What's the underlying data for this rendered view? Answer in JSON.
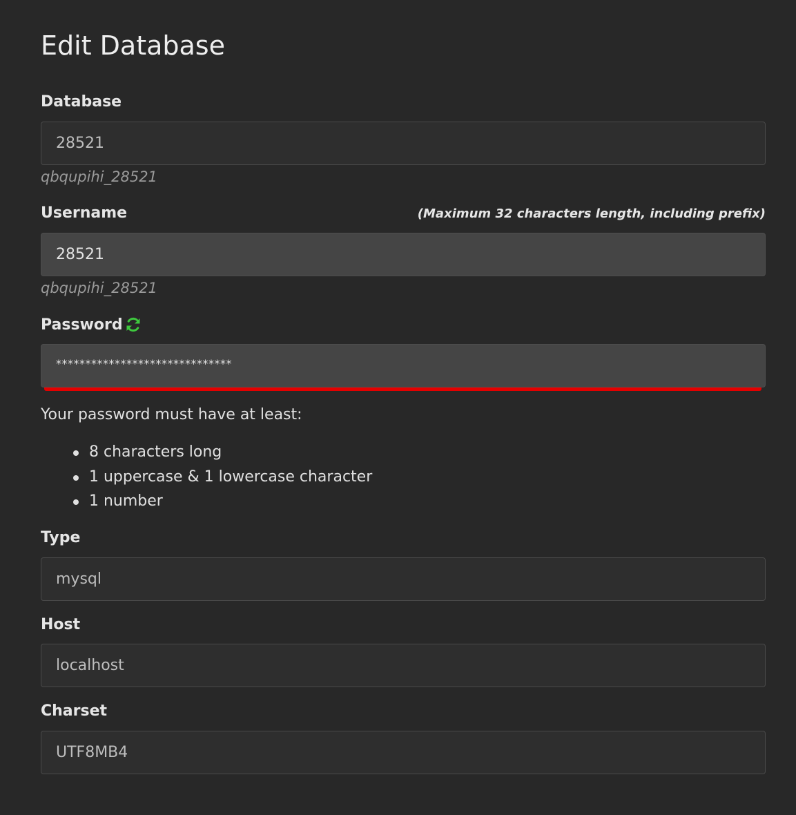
{
  "page": {
    "title": "Edit Database"
  },
  "database": {
    "label": "Database",
    "value": "28521",
    "prefixed": "qbqupihi_28521"
  },
  "username": {
    "label": "Username",
    "hint": "(Maximum 32 characters length, including prefix)",
    "value": "28521",
    "prefixed": "qbqupihi_28521"
  },
  "password": {
    "label": "Password",
    "value": "******************************",
    "refresh_icon": "refresh-icon",
    "status_color": "#e40000",
    "requirements_intro": "Your password must have at least:",
    "requirements": [
      "8 characters long",
      "1 uppercase & 1 lowercase character",
      "1 number"
    ]
  },
  "type": {
    "label": "Type",
    "value": "mysql"
  },
  "host": {
    "label": "Host",
    "value": "localhost"
  },
  "charset": {
    "label": "Charset",
    "value": "UTF8MB4"
  },
  "colors": {
    "background": "#282828",
    "accent_green": "#3ec93e",
    "error_red": "#e40000"
  }
}
